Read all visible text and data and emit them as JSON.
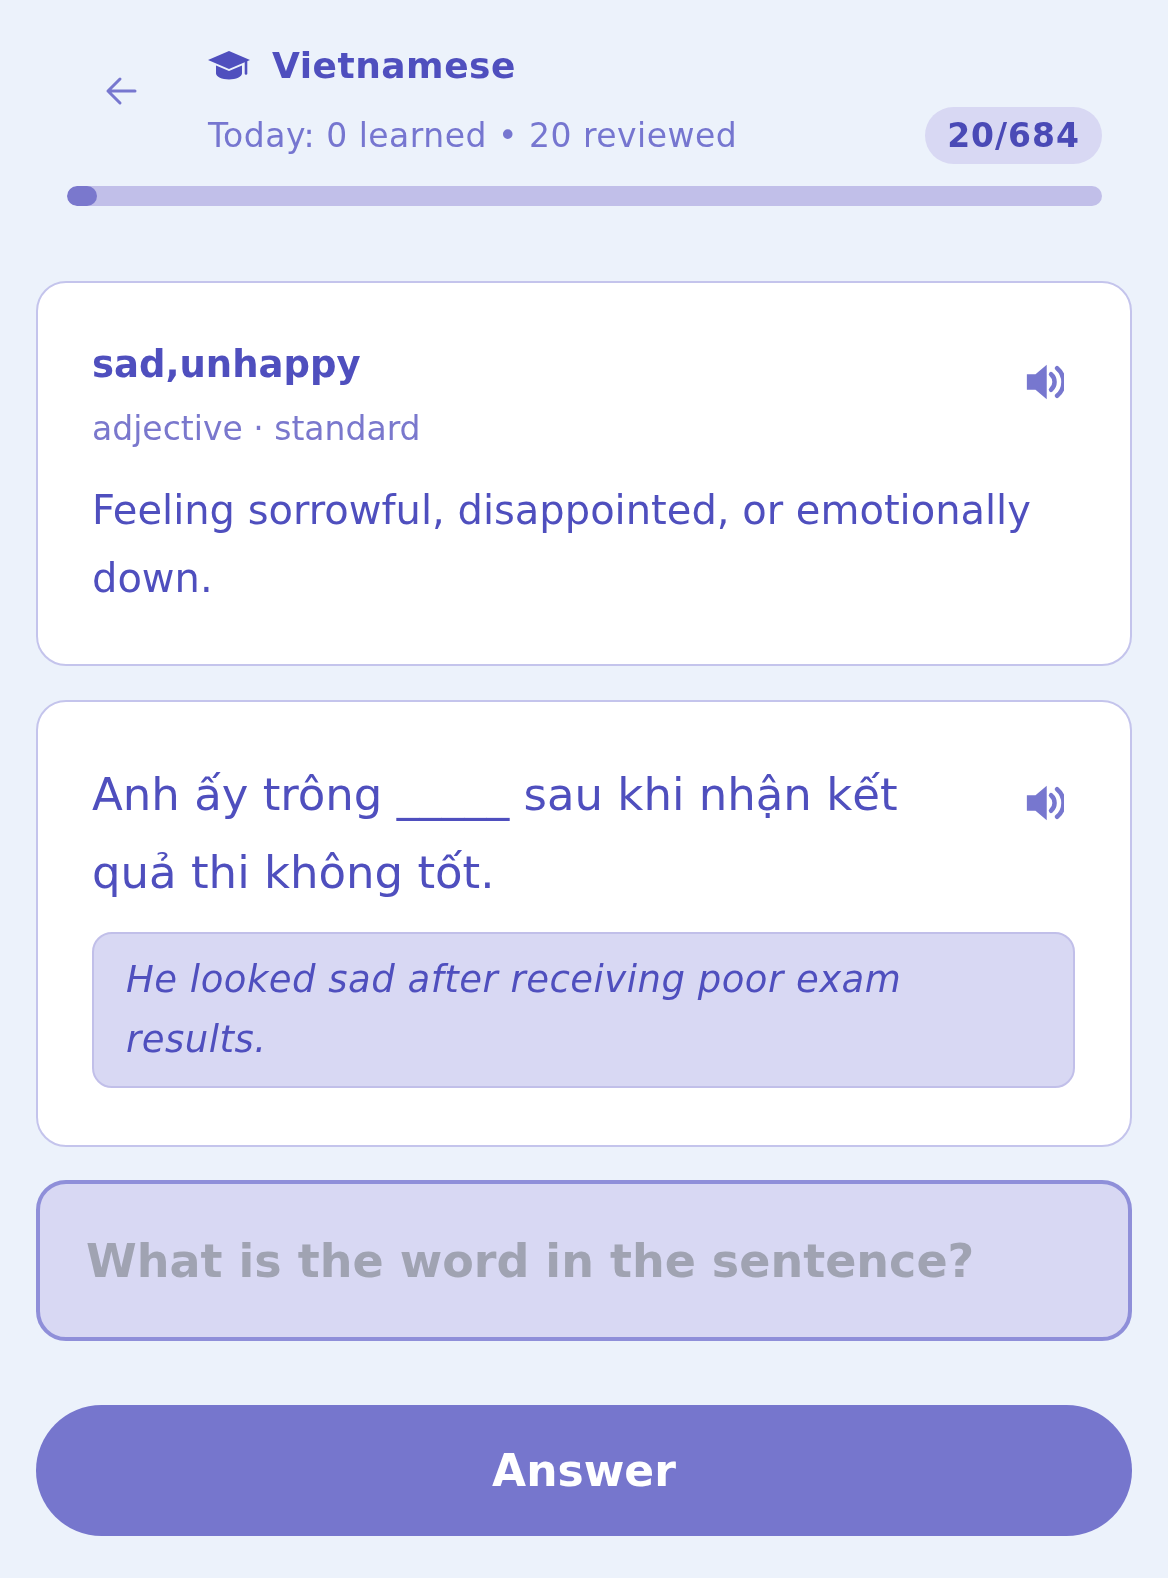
{
  "header": {
    "title": "Vietnamese",
    "subtitle": "Today: 0 learned • 20 reviewed",
    "counter": "20/684",
    "progress": {
      "level": 0.029
    }
  },
  "word_card": {
    "term": "sad,unhappy",
    "meta": "adjective · standard",
    "definition": "Feeling sorrowful, disappointed, or emotionally down."
  },
  "example_card": {
    "sentence": "Anh ấy trông _____ sau khi nhận kết quả thi không tốt.",
    "translation": "He looked sad after receiving poor exam results."
  },
  "answer_field": {
    "placeholder": "What is the word in the sentence?"
  },
  "submit_button": {
    "label": "Answer"
  }
}
